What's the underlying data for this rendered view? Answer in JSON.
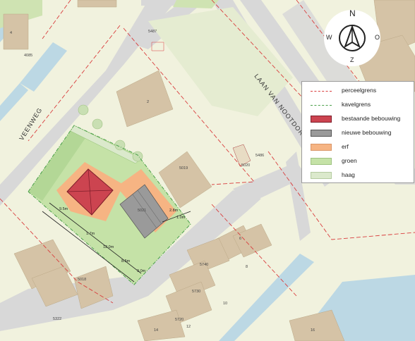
{
  "map": {
    "streets": {
      "veenweg": "VEENWEG",
      "laan": "LAAN VAN NOOTDORP"
    },
    "house_numbers": {
      "n2": "2",
      "n4": "4",
      "n6": "6",
      "n8": "8",
      "n10": "10",
      "n12": "12",
      "n14": "14",
      "n16": "16",
      "n5487": "5487",
      "n5486": "5486",
      "n4085": "4085",
      "n5019": "5019",
      "n5020": "5020",
      "n5021": "5021",
      "n5018": "5018",
      "n5322": "5322",
      "n5720": "5720",
      "n5730": "5730",
      "n5740": "5740"
    },
    "dimensions": {
      "d1": "9.5m",
      "d2": "1.7m",
      "d3": "12.0m",
      "d4": "8.5m",
      "d5": "9.0m",
      "d6": "2.8m",
      "d7": "1.0m"
    }
  },
  "legend": {
    "items": [
      {
        "label": "perceelgrens",
        "symbol": "dash",
        "color": "#d93d3d"
      },
      {
        "label": "kavelgrens",
        "symbol": "dash",
        "color": "#4aa04a"
      },
      {
        "label": "bestaande bebouwing",
        "symbol": "fill",
        "color": "#cc4450"
      },
      {
        "label": "nieuwe bebouwing",
        "symbol": "fill",
        "color": "#9a9a9a"
      },
      {
        "label": "erf",
        "symbol": "fill",
        "color": "#f6b483"
      },
      {
        "label": "groen",
        "symbol": "fill",
        "color": "#c5e2a7"
      },
      {
        "label": "haag",
        "symbol": "fill",
        "color": "#dbe9cc"
      }
    ]
  },
  "compass": {
    "n": "N",
    "o": "O",
    "z": "Z",
    "w": "W"
  },
  "colors": {
    "base": "#f1f2de",
    "street": "#d8d8d8",
    "water": "#bcd8e4",
    "building": "#d5c3a6",
    "plot": "#c5e2a7",
    "erf": "#f6b483",
    "existing": "#cc4450",
    "new": "#9a9a9a",
    "boundary": "#d93d3d",
    "kavel": "#4aa04a"
  }
}
